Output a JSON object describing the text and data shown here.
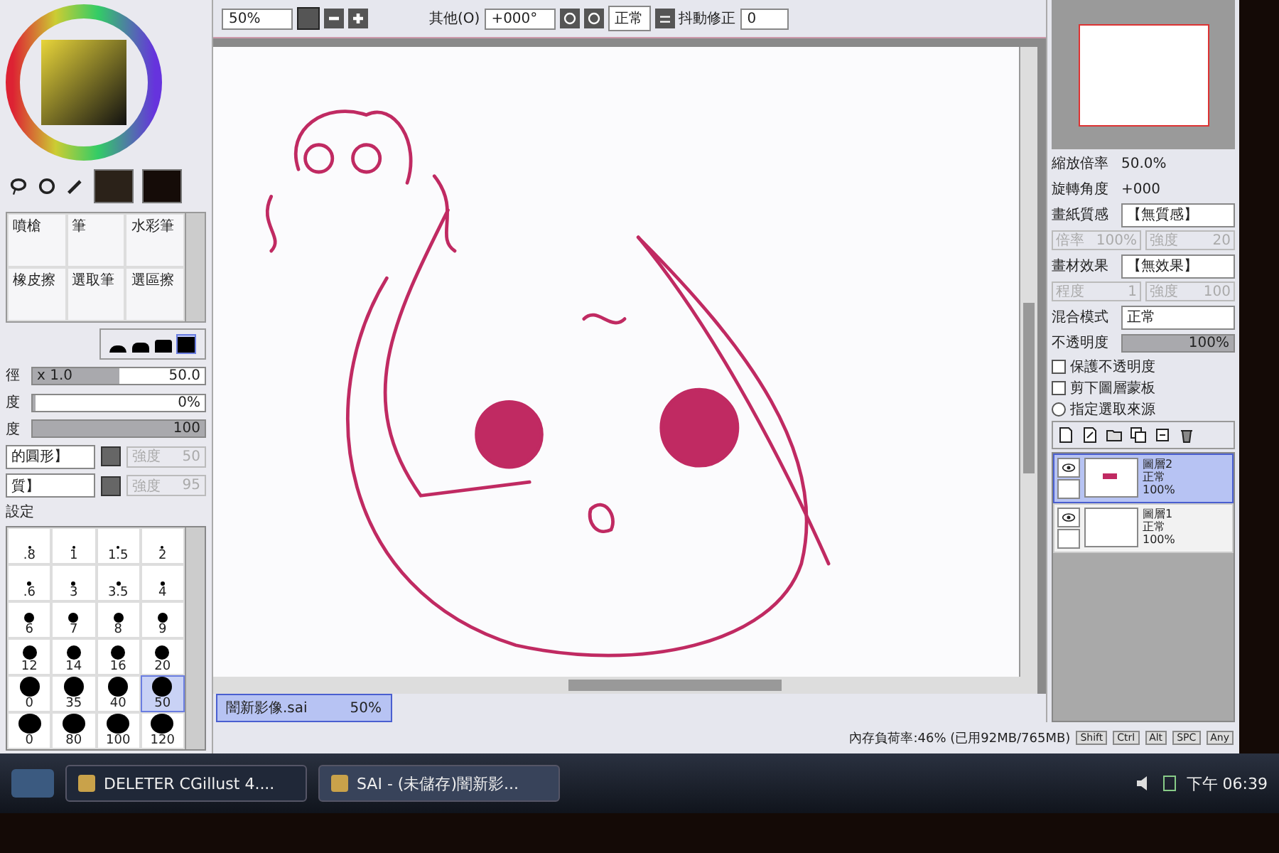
{
  "toolbar": {
    "zoom": "50%",
    "menu": "其他(O)",
    "rotation": "+000°",
    "blend": "正常",
    "stabilizer_label": "抖動修正",
    "stabilizer": "0"
  },
  "tools": [
    {
      "label": "噴槍",
      "selected": false
    },
    {
      "label": "筆",
      "selected": false
    },
    {
      "label": "水彩筆",
      "selected": false
    },
    {
      "label": "橡皮擦",
      "selected": false
    },
    {
      "label": "選取筆",
      "selected": false
    },
    {
      "label": "選區擦",
      "selected": false
    }
  ],
  "brush_shapes": [
    {
      "selected": false
    },
    {
      "selected": false
    },
    {
      "selected": false
    },
    {
      "selected": true
    }
  ],
  "brush_params": [
    {
      "label": "徑",
      "multiplier": "x 1.0",
      "value": "50.0",
      "level": 0.5
    },
    {
      "label": "度",
      "value": "0%",
      "level": 0
    },
    {
      "label": "度",
      "value": "100",
      "level": 1
    }
  ],
  "brush_textures": [
    {
      "label": "的圓形】",
      "strength_label": "強度",
      "strength": "50"
    },
    {
      "label": "質】",
      "strength_label": "強度",
      "strength": "95"
    }
  ],
  "detail_label": "設定",
  "brush_sizes": [
    {
      "label": ".8",
      "selected": false
    },
    {
      "label": "1",
      "selected": false
    },
    {
      "label": "1.5",
      "selected": false
    },
    {
      "label": "2",
      "selected": false
    },
    {
      "label": ".6",
      "selected": false
    },
    {
      "label": "3",
      "selected": false
    },
    {
      "label": "3.5",
      "selected": false
    },
    {
      "label": "4",
      "selected": false
    },
    {
      "label": "6",
      "selected": false
    },
    {
      "label": "7",
      "selected": false
    },
    {
      "label": "8",
      "selected": false
    },
    {
      "label": "9",
      "selected": false
    },
    {
      "label": "12",
      "selected": false
    },
    {
      "label": "14",
      "selected": false
    },
    {
      "label": "16",
      "selected": false
    },
    {
      "label": "20",
      "selected": false
    },
    {
      "label": "0",
      "selected": false
    },
    {
      "label": "35",
      "selected": false
    },
    {
      "label": "40",
      "selected": false
    },
    {
      "label": "50",
      "selected": true
    },
    {
      "label": "0",
      "selected": false
    },
    {
      "label": "80",
      "selected": false
    },
    {
      "label": "100",
      "selected": false
    },
    {
      "label": "120",
      "selected": false
    }
  ],
  "document_tab": {
    "name": "闇新影像.sai",
    "zoom": "50%",
    "selected": true
  },
  "navigator": {
    "zoom_label": "縮放倍率",
    "zoom": "50.0%",
    "rotation_label": "旋轉角度",
    "rotation": "+000"
  },
  "paper": {
    "label": "畫紙質感",
    "value": "【無質感】",
    "scale_label": "倍率",
    "scale": "100%",
    "strength_label": "強度",
    "strength": "20"
  },
  "effect": {
    "label": "畫材效果",
    "value": "【無效果】",
    "degree_label": "程度",
    "degree": "1",
    "strength_label": "強度",
    "strength": "100"
  },
  "blend": {
    "label": "混合模式",
    "value": "正常"
  },
  "opacity": {
    "label": "不透明度",
    "value": "100%",
    "level": 1
  },
  "options": [
    {
      "kind": "checkbox",
      "label": "保護不透明度",
      "checked": false
    },
    {
      "kind": "checkbox",
      "label": "剪下圖層蒙板",
      "checked": false
    },
    {
      "kind": "radio",
      "label": "指定選取來源",
      "checked": false
    }
  ],
  "layers": [
    {
      "name": "圖層2",
      "mode": "正常",
      "opacity": "100%",
      "selected": true,
      "visible": true,
      "has_sketch": true
    },
    {
      "name": "圖層1",
      "mode": "正常",
      "opacity": "100%",
      "selected": false,
      "visible": true,
      "has_sketch": false
    }
  ],
  "status": {
    "memory": "內存負荷率:46% (已用92MB/765MB)",
    "keys": [
      "Shift",
      "Ctrl",
      "Alt",
      "SPC",
      "Any"
    ]
  },
  "taskbar": {
    "tasks": [
      {
        "label": "DELETER CGillust 4....",
        "selected": false
      },
      {
        "label": "SAI - (未儲存)闇新影...",
        "selected": true
      }
    ],
    "time": "下午 06:39"
  }
}
